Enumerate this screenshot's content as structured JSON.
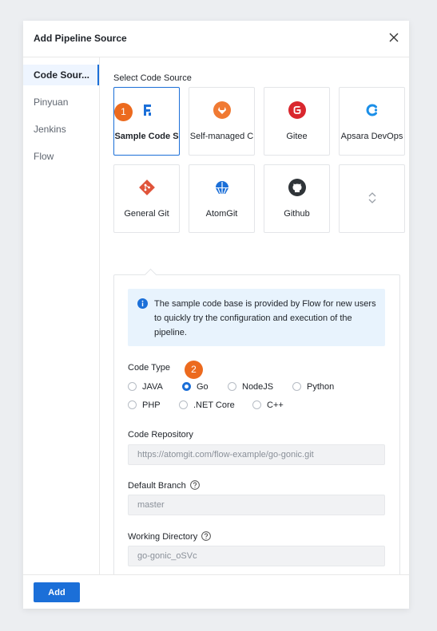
{
  "dialog": {
    "title": "Add Pipeline Source"
  },
  "sidebar": {
    "items": [
      {
        "label": "Code Sour...",
        "active": true
      },
      {
        "label": "Pinyuan"
      },
      {
        "label": "Jenkins"
      },
      {
        "label": "Flow"
      }
    ]
  },
  "source": {
    "section_label": "Select Code Source",
    "cards": [
      {
        "label": "Sample Code S",
        "icon": "flow-logo-icon",
        "selected": true
      },
      {
        "label": "Self-managed C",
        "icon": "gitlab-icon"
      },
      {
        "label": "Gitee",
        "icon": "gitee-icon"
      },
      {
        "label": "Apsara DevOps",
        "icon": "apsara-devops-icon"
      },
      {
        "label": "General Git",
        "icon": "git-icon"
      },
      {
        "label": "AtomGit",
        "icon": "atomgit-icon"
      },
      {
        "label": "Github",
        "icon": "github-icon"
      },
      {
        "label": "",
        "icon": "expand-icon"
      }
    ]
  },
  "badges": {
    "step1": "1",
    "step2": "2"
  },
  "panel": {
    "info": "The sample code base is provided by Flow for new users to quickly try the configuration and execution of the pipeline.",
    "code_type": {
      "label": "Code Type",
      "options": [
        "JAVA",
        "Go",
        "NodeJS",
        "Python",
        "PHP",
        ".NET Core",
        "C++"
      ],
      "selected": "Go"
    },
    "repository": {
      "label": "Code Repository",
      "value": "https://atomgit.com/flow-example/go-gonic.git"
    },
    "branch": {
      "label": "Default Branch",
      "value": "master"
    },
    "workdir": {
      "label": "Working Directory",
      "value": "go-gonic_oSVc"
    }
  },
  "footer": {
    "add_label": "Add"
  },
  "colors": {
    "primary": "#1b6fd8",
    "badge": "#ec6a1e",
    "info_bg": "#e8f3fd",
    "gitlab": "#f07a33",
    "gitee": "#d9272e"
  }
}
